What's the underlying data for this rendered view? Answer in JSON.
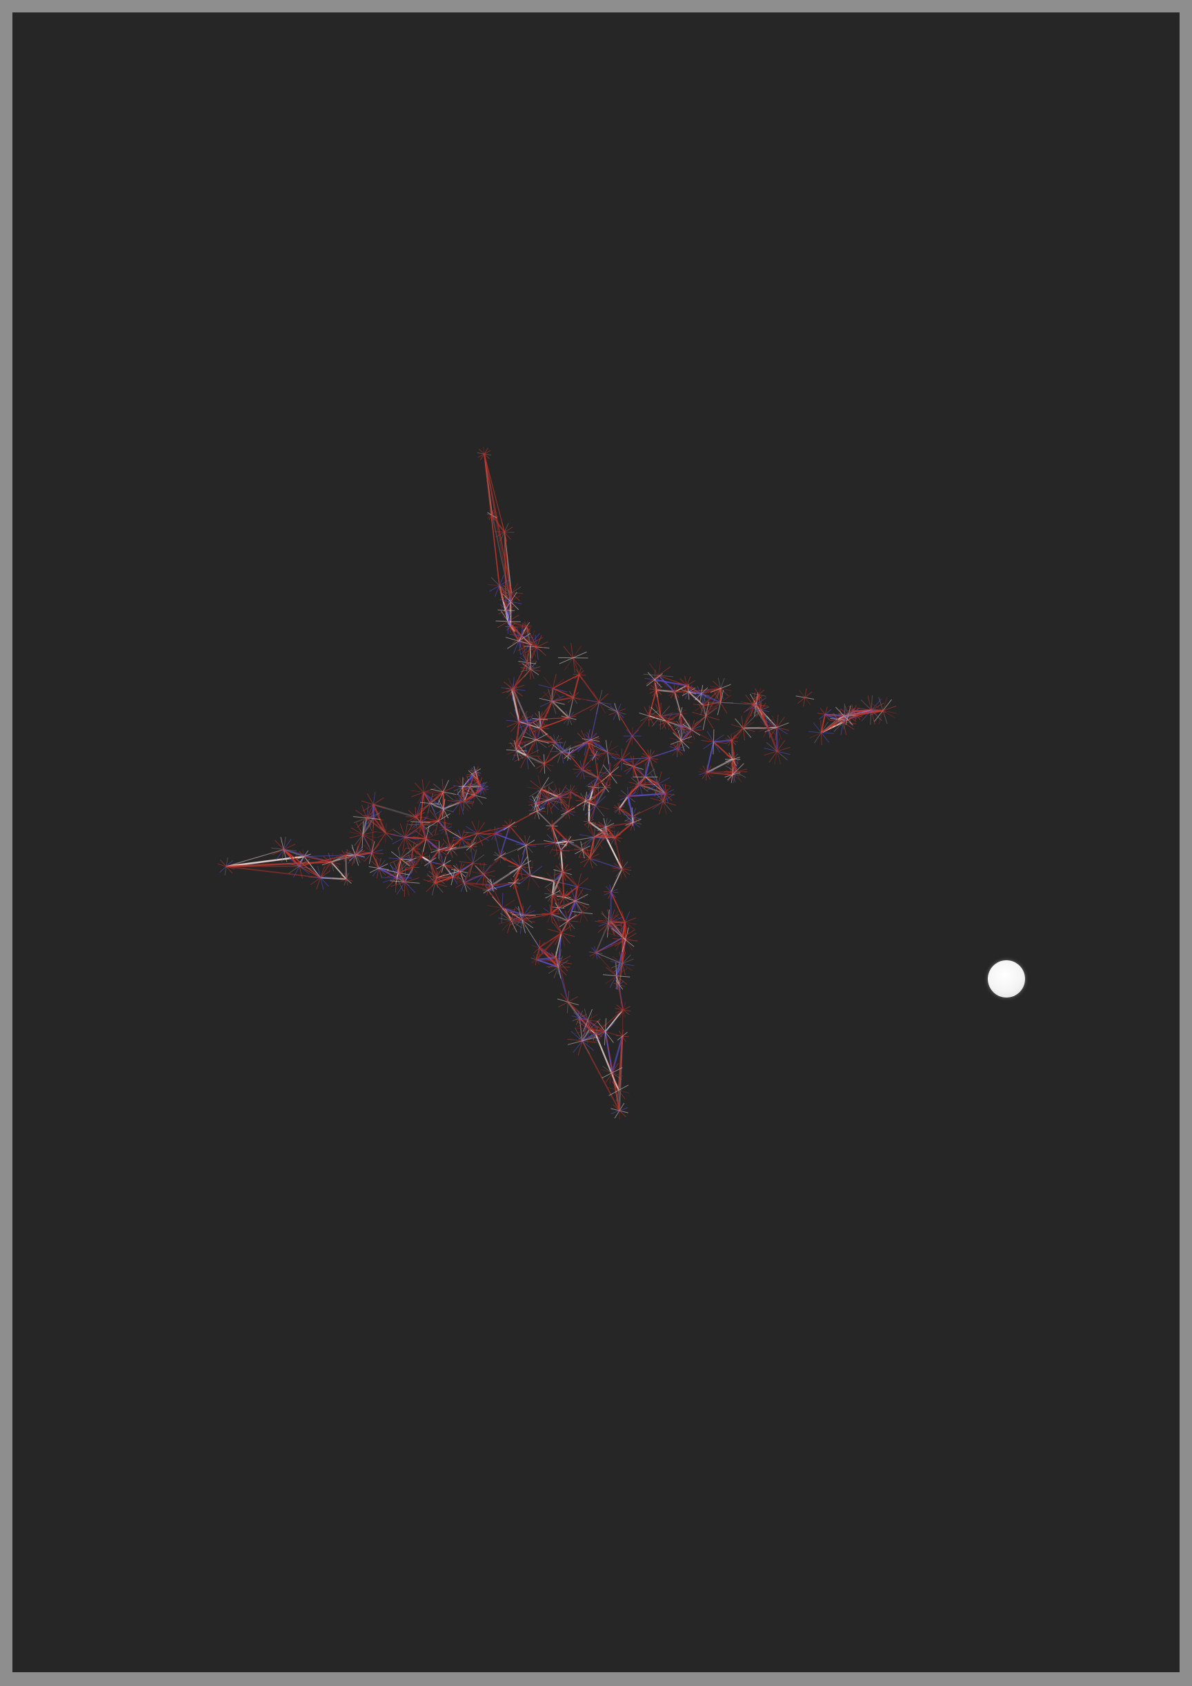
{
  "scene": {
    "background_color": "#262626",
    "frame_color": "#8e8e8e",
    "mesh_colors": {
      "red": "#c8372d",
      "dark_red": "#8a2a24",
      "blue": "#5a4fd0",
      "white": "#e8d6d2",
      "gray": "#7d6f73"
    },
    "dot_color": "#ffffff",
    "icons": [
      "star-mesh-icon",
      "light-dot-icon"
    ]
  }
}
